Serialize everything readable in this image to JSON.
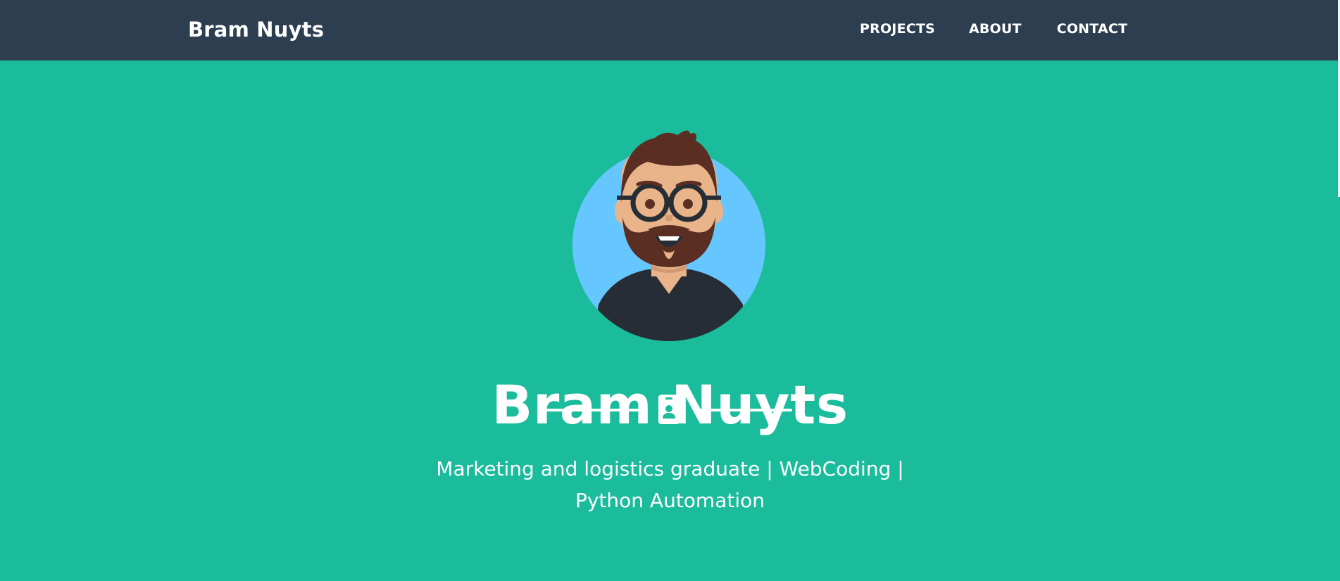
{
  "navbar": {
    "brand": "Bram Nuyts",
    "links": [
      {
        "label": "PROJECTS"
      },
      {
        "label": "ABOUT"
      },
      {
        "label": "CONTACT"
      }
    ],
    "background": "#2c3e50"
  },
  "hero": {
    "avatar_icon": "bearded-man-avatar-icon",
    "heading": "Bram Nuyts",
    "divider_icon": "id-badge-icon",
    "subheading": "Marketing and logistics graduate | WebCoding | Python Automation",
    "background": "#1abc9c"
  }
}
